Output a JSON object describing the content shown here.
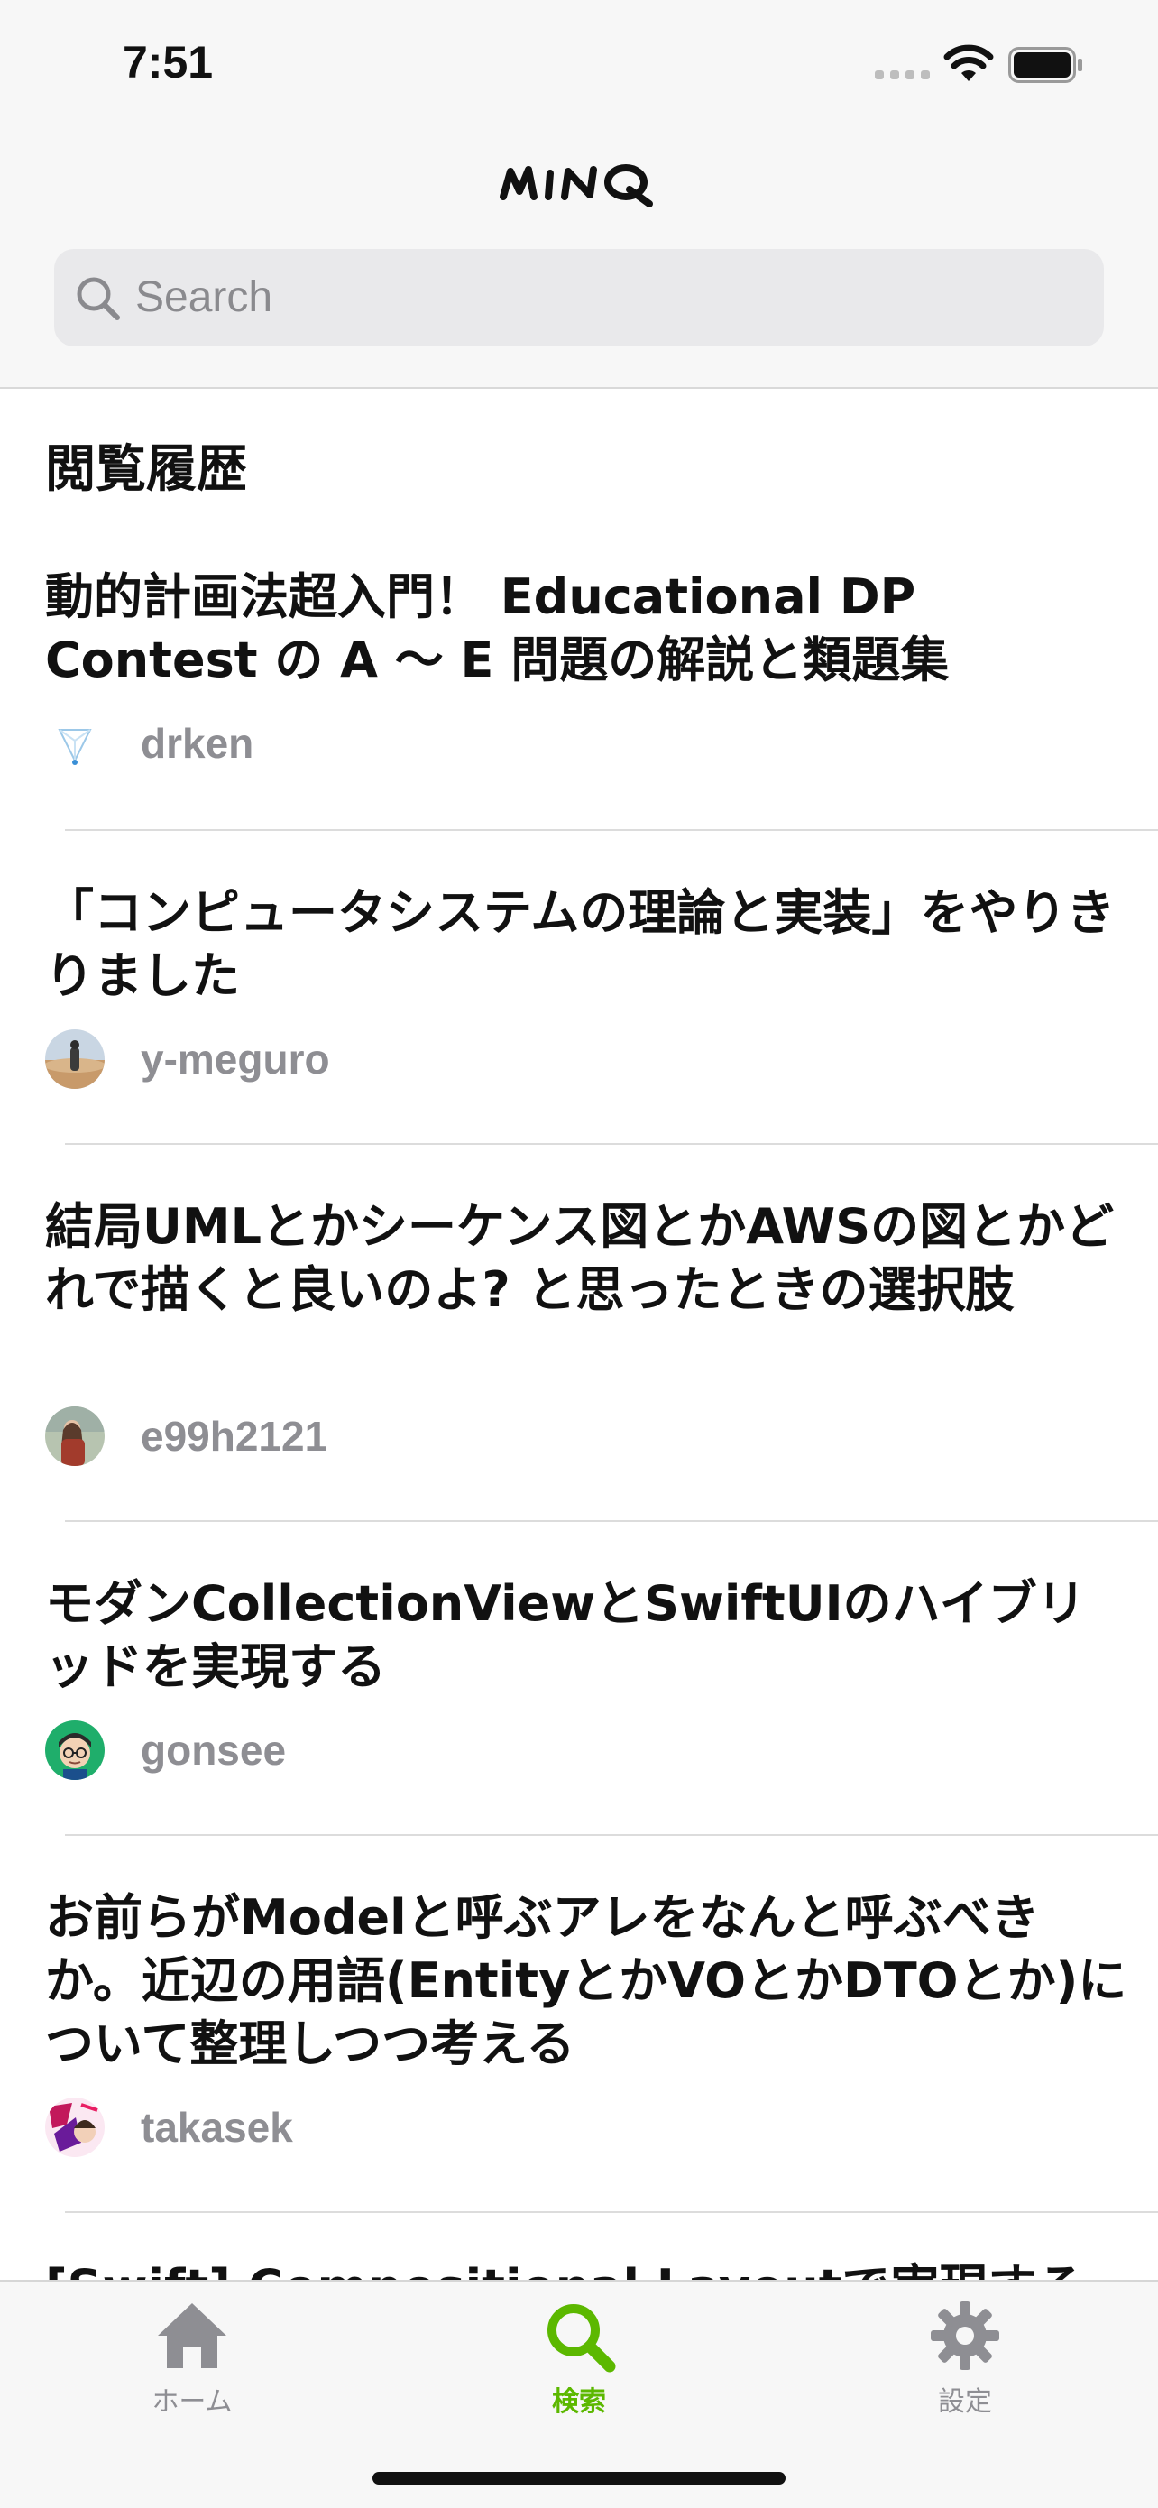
{
  "status_bar": {
    "time": "7:51"
  },
  "header": {
    "logo_text": "MINQ",
    "search_placeholder": "Search"
  },
  "history": {
    "section_title": "閲覧履歴",
    "articles": [
      {
        "title": "動的計画法超入門！ Educational DP Contest の A 〜 E 問題の解説と類題集",
        "author": "drken",
        "avatar": "diamond-logo-avatar"
      },
      {
        "title": "「コンピュータシステムの理論と実装」をやりきりました",
        "author": "y-meguro",
        "avatar": "desert-traveler-avatar"
      },
      {
        "title": "結局UMLとかシーケンス図とかAWSの図とかどれで描くと良いのよ? と思ったときの選択肢",
        "author": "e99h2121",
        "avatar": "person-portrait-avatar"
      },
      {
        "title": "モダンCollectionViewとSwiftUIのハイブリッドを実現する",
        "author": "gonsee",
        "avatar": "cartoon-glasses-avatar"
      },
      {
        "title": "お前らがModelと呼ぶアレをなんと呼ぶべきか。近辺の用語(EntityとかVOとかDTOとか)について整理しつつ考える",
        "author": "takasek",
        "avatar": "comic-art-avatar"
      },
      {
        "title": "[Swift] Compositional Layoutで実現する"
      }
    ]
  },
  "tab_bar": {
    "tabs": [
      {
        "label": "ホーム",
        "icon": "house-icon",
        "active": false
      },
      {
        "label": "検索",
        "icon": "magnifier-icon",
        "active": true
      },
      {
        "label": "設定",
        "icon": "gear-icon",
        "active": false
      }
    ]
  },
  "colors": {
    "accent": "#5cb800",
    "inactive": "#8e8e93",
    "background": "#f7f7f7"
  }
}
